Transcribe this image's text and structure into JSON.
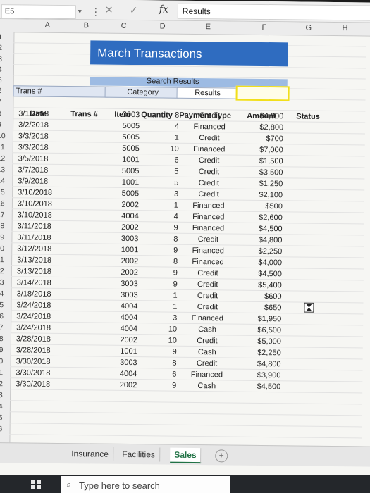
{
  "formula_bar": {
    "cell_ref": "E5",
    "fx": "fx",
    "content": "Results"
  },
  "columns": [
    "A",
    "B",
    "C",
    "D",
    "E",
    "F",
    "G",
    "H"
  ],
  "rows": [
    "1",
    "2",
    "3",
    "4",
    "5",
    "6",
    "7",
    "8",
    "9",
    "10",
    "11",
    "12",
    "13",
    "14",
    "15",
    "16",
    "17",
    "18",
    "19",
    "20",
    "21",
    "22",
    "23",
    "24",
    "25",
    "26",
    "27",
    "28",
    "29",
    "30",
    "31",
    "32",
    "33",
    "34",
    "35",
    "36"
  ],
  "title": "March Transactions",
  "search": {
    "band_label": "Search Results",
    "trans_label": "Trans #",
    "category_label": "Category",
    "results_label": "Results"
  },
  "table": {
    "headers": {
      "date": "Date",
      "trans": "Trans #",
      "item": "Item",
      "quantity": "Quantity",
      "payment": "Payment Type",
      "amount": "Amount",
      "status": "Status"
    },
    "rows": [
      {
        "date": "3/1/2018",
        "item": "3003",
        "qty": "8",
        "pay": "Credit",
        "amt": "$4,800"
      },
      {
        "date": "3/2/2018",
        "item": "5005",
        "qty": "4",
        "pay": "Financed",
        "amt": "$2,800"
      },
      {
        "date": "3/3/2018",
        "item": "5005",
        "qty": "1",
        "pay": "Credit",
        "amt": "$700"
      },
      {
        "date": "3/3/2018",
        "item": "5005",
        "qty": "10",
        "pay": "Financed",
        "amt": "$7,000"
      },
      {
        "date": "3/5/2018",
        "item": "1001",
        "qty": "6",
        "pay": "Credit",
        "amt": "$1,500"
      },
      {
        "date": "3/7/2018",
        "item": "5005",
        "qty": "5",
        "pay": "Credit",
        "amt": "$3,500"
      },
      {
        "date": "3/9/2018",
        "item": "1001",
        "qty": "5",
        "pay": "Credit",
        "amt": "$1,250"
      },
      {
        "date": "3/10/2018",
        "item": "5005",
        "qty": "3",
        "pay": "Credit",
        "amt": "$2,100"
      },
      {
        "date": "3/10/2018",
        "item": "2002",
        "qty": "1",
        "pay": "Financed",
        "amt": "$500"
      },
      {
        "date": "3/10/2018",
        "item": "4004",
        "qty": "4",
        "pay": "Financed",
        "amt": "$2,600"
      },
      {
        "date": "3/11/2018",
        "item": "2002",
        "qty": "9",
        "pay": "Financed",
        "amt": "$4,500"
      },
      {
        "date": "3/11/2018",
        "item": "3003",
        "qty": "8",
        "pay": "Credit",
        "amt": "$4,800"
      },
      {
        "date": "3/12/2018",
        "item": "1001",
        "qty": "9",
        "pay": "Financed",
        "amt": "$2,250"
      },
      {
        "date": "3/13/2018",
        "item": "2002",
        "qty": "8",
        "pay": "Financed",
        "amt": "$4,000"
      },
      {
        "date": "3/13/2018",
        "item": "2002",
        "qty": "9",
        "pay": "Credit",
        "amt": "$4,500"
      },
      {
        "date": "3/14/2018",
        "item": "3003",
        "qty": "9",
        "pay": "Credit",
        "amt": "$5,400"
      },
      {
        "date": "3/18/2018",
        "item": "3003",
        "qty": "1",
        "pay": "Credit",
        "amt": "$600"
      },
      {
        "date": "3/24/2018",
        "item": "4004",
        "qty": "1",
        "pay": "Credit",
        "amt": "$650"
      },
      {
        "date": "3/24/2018",
        "item": "4004",
        "qty": "3",
        "pay": "Financed",
        "amt": "$1,950"
      },
      {
        "date": "3/24/2018",
        "item": "4004",
        "qty": "10",
        "pay": "Cash",
        "amt": "$6,500"
      },
      {
        "date": "3/28/2018",
        "item": "2002",
        "qty": "10",
        "pay": "Credit",
        "amt": "$5,000"
      },
      {
        "date": "3/28/2018",
        "item": "1001",
        "qty": "9",
        "pay": "Cash",
        "amt": "$2,250"
      },
      {
        "date": "3/30/2018",
        "item": "3003",
        "qty": "8",
        "pay": "Credit",
        "amt": "$4,800"
      },
      {
        "date": "3/30/2018",
        "item": "4004",
        "qty": "6",
        "pay": "Financed",
        "amt": "$3,900"
      },
      {
        "date": "3/30/2018",
        "item": "2002",
        "qty": "9",
        "pay": "Cash",
        "amt": "$4,500"
      }
    ]
  },
  "sheet_tabs": [
    "Insurance",
    "Facilities",
    "Sales"
  ],
  "active_tab": "Sales",
  "taskbar": {
    "search_placeholder": "Type here to search"
  },
  "colors": {
    "banner": "#2f6cc0",
    "tab_accent": "#207245",
    "highlight": "#f2df1a"
  }
}
